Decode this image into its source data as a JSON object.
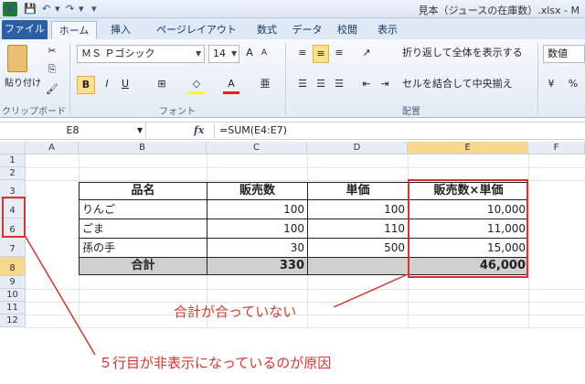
{
  "window": {
    "app_icon": "X",
    "title": "見本（ジュースの在庫数）.xlsx - M"
  },
  "quick_access": {
    "save": "💾",
    "undo": "↶",
    "redo": "↷",
    "menu": "▾"
  },
  "tabs": {
    "file": "ファイル",
    "home": "ホーム",
    "insert": "挿入",
    "layout": "ページレイアウト",
    "formula": "数式",
    "data": "データ",
    "review": "校閲",
    "view": "表示"
  },
  "ribbon": {
    "clipboard": {
      "paste": "貼り付け",
      "label": "クリップボード"
    },
    "font": {
      "name": "ＭＳ Ｐゴシック",
      "size": "14",
      "label": "フォント",
      "bold": "B",
      "italic": "I",
      "underline": "U",
      "grow": "A",
      "shrink": "A",
      "color_letter": "A",
      "fill_icon": "◇",
      "border_icon": "⊞",
      "phonetic": "亜"
    },
    "alignment": {
      "wrap": "折り返して全体を表示する",
      "merge": "セルを結合して中央揃え",
      "label": "配置"
    },
    "number": {
      "format": "数値"
    }
  },
  "formula_bar": {
    "name_box": "E8",
    "fx": "fx",
    "formula": "=SUM(E4:E7)"
  },
  "columns": [
    "A",
    "B",
    "C",
    "D",
    "E",
    "F"
  ],
  "rows": [
    "1",
    "2",
    "3",
    "4",
    "6",
    "7",
    "8",
    "9",
    "10",
    "11",
    "12"
  ],
  "table": {
    "headers": [
      "品名",
      "販売数",
      "単価",
      "販売数×単価"
    ],
    "rows": [
      {
        "item": "りんご",
        "qty": "100",
        "price": "100",
        "total": "10,000"
      },
      {
        "item": "ごま",
        "qty": "100",
        "price": "110",
        "total": "11,000"
      },
      {
        "item": "孫の手",
        "qty": "30",
        "price": "500",
        "total": "15,000"
      }
    ],
    "sum_label": "合計",
    "sum_qty": "330",
    "sum_total": "46,000"
  },
  "annotations": {
    "mismatch": "合計が合っていない",
    "cause": "５行目が非表示になっているのが原因",
    "color": "#d9342b"
  }
}
